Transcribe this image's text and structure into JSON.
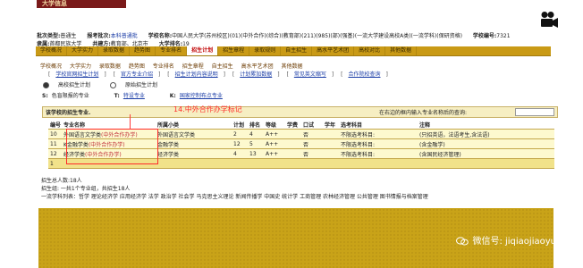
{
  "banner": {
    "title": "大学信息"
  },
  "school": {
    "batch_label": "批次类型:",
    "batch": "普通生",
    "plan_label": "报考批次:",
    "plan": "本科普通批",
    "name_label": "学校名称:",
    "name": "中国人民大学(苏州校区)(01)(中外合作)(综合)(教育部)(211)(985)(部)(强基)(一流大学建设高校A类)(一流学科)(保研资格)",
    "code_label": "学校编号:",
    "code": "7321",
    "affil_label": "隶属:",
    "affil": "首都民族大学",
    "build_label": "共建方:",
    "build": "教育部、北京市",
    "count_label": "大学排名:",
    "count": "19"
  },
  "tabs": [
    "学校概况",
    "大学实力",
    "录取数据",
    "趋势图",
    "专业排名",
    "招生计划",
    "招生章程",
    "录取规则",
    "自主招生",
    "高水平艺术团",
    "高校对比",
    "其他数据"
  ],
  "subnav": [
    "学校概况",
    "大学实力",
    "录取数据",
    "趋势图",
    "专业排名",
    "招生章程",
    "自主招生",
    "高水平艺术团",
    "其他数据"
  ],
  "links": [
    "学校官网招生计划",
    "官方专业介绍",
    "招生计划内容说明",
    "计划累加数据",
    "常见英文缩写",
    "合作院校查询"
  ],
  "radios": [
    {
      "label": "高校招生计划",
      "on": true
    },
    {
      "label": "原始招生计划",
      "on": false
    }
  ],
  "legend": [
    {
      "k": "S:",
      "text": "色盲限报的专业",
      "link": false
    },
    {
      "k": "T:",
      "text": "特设专业",
      "link": true
    },
    {
      "k": "K:",
      "text": "国家控制布点专业",
      "link": true
    }
  ],
  "searchbar": {
    "left": "该学校的招生专业.",
    "right": "在右边的框内输入专业名称后的查询:"
  },
  "annotation": "14.中外合作办学标记",
  "table": {
    "headers": [
      "编号",
      "专业名称",
      "",
      "所属小类",
      "计划",
      "排名",
      "等级",
      "学费",
      "口试",
      "学年",
      "选考科目",
      "注释"
    ],
    "rows": [
      {
        "id": "10",
        "name": "外国语言文学类",
        "tag": "(中外合作办学)",
        "cat": "外国语言文学类",
        "plan": "2",
        "rank": "4",
        "grade": "A++",
        "fee": "",
        "oral": "否",
        "year": "",
        "subj": "不限选考科目:",
        "note": "(只招英语，法语考生,含法语)"
      },
      {
        "id": "11",
        "name": "K金融学类",
        "tag": "(中外合作办学)",
        "cat": "金融学类",
        "plan": "12",
        "rank": "5",
        "grade": "A++",
        "fee": "",
        "oral": "否",
        "year": "",
        "subj": "不限选考科目:",
        "note": "(含金融学)"
      },
      {
        "id": "12",
        "name": "经济学类",
        "tag": "(中外合作办学)",
        "cat": "经济学类",
        "plan": "4",
        "rank": "13",
        "grade": "A++",
        "fee": "",
        "oral": "否",
        "year": "",
        "subj": "不限选考科目:",
        "note": "(含国民经济管理)"
      }
    ],
    "footer_count": "1"
  },
  "summary": {
    "total": "招生总人数:18人",
    "groups": "招生组:    一共1个专业组，共招生18人",
    "disciplines": "一流学科列表：哲学  理论经济学  应用经济学  法学  政治学  社会学  马克思主义理论  新闻传播学  中国史  统计学  工商管理  农林经济管理  公共管理  图书情报与档案管理"
  },
  "watermark": "微信号: jiqiaojiaoyu"
}
